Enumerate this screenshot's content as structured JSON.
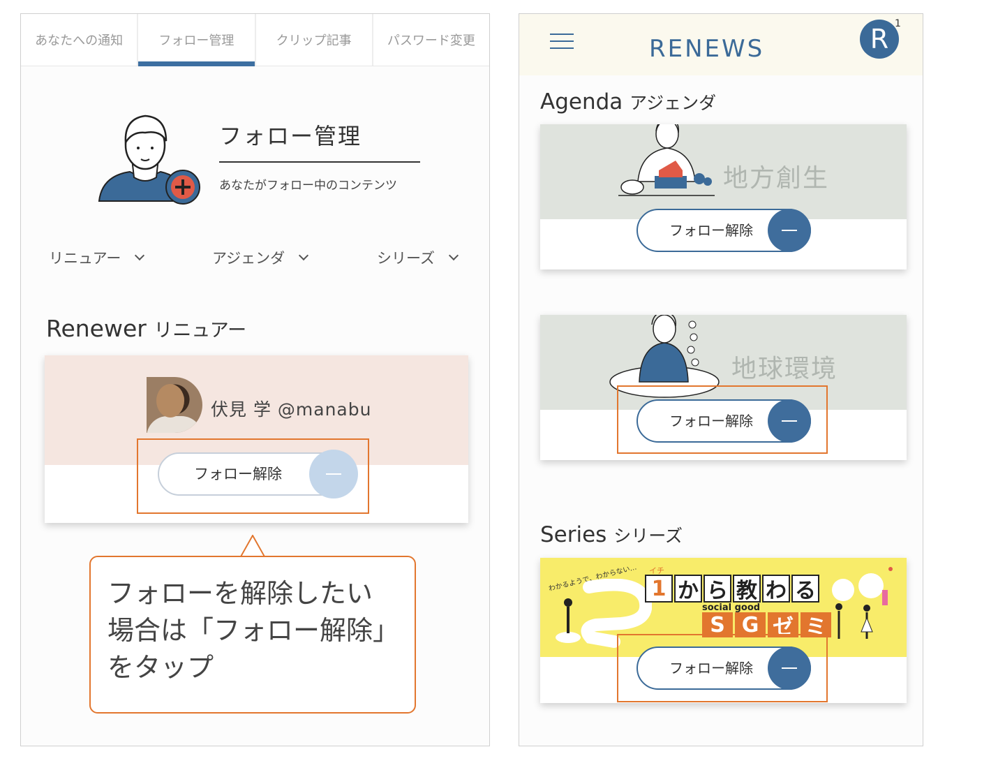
{
  "left": {
    "tabs": [
      {
        "label": "あなたへの通知"
      },
      {
        "label": "フォロー管理"
      },
      {
        "label": "クリップ記事"
      },
      {
        "label": "パスワード変更"
      }
    ],
    "hero": {
      "title": "フォロー管理",
      "subtitle": "あなたがフォロー中のコンテンツ"
    },
    "filters": [
      {
        "label": "リニュアー"
      },
      {
        "label": "アジェンダ"
      },
      {
        "label": "シリーズ"
      }
    ],
    "section": {
      "title_en": "Renewer",
      "title_jp": "リニュアー"
    },
    "renewer": {
      "name": "伏見 学 @manabu",
      "unfollow_label": "フォロー解除"
    },
    "callout": {
      "text": "フォローを解除したい\n場合は「フォロー解除」\nをタップ"
    }
  },
  "right": {
    "logo": "RENEWS",
    "notification_count": "1",
    "user_icon": "R",
    "agenda": {
      "title_en": "Agenda",
      "title_jp": "アジェンダ",
      "items": [
        {
          "label": "地方創生",
          "unfollow_label": "フォロー解除"
        },
        {
          "label": "地球環境",
          "unfollow_label": "フォロー解除"
        }
      ]
    },
    "series": {
      "title_en": "Series",
      "title_jp": "シリーズ",
      "banner": {
        "kana": "イチ",
        "tagline": "わかるようで、わからない…",
        "title_chars": [
          "1",
          "か",
          "ら",
          "教",
          "わ",
          "る"
        ],
        "sub": "social good",
        "row_chars": [
          "S",
          "G",
          "ゼ",
          "ミ"
        ]
      },
      "unfollow_label": "フォロー解除"
    }
  },
  "colors": {
    "accent": "#3b6a98",
    "highlight": "#e2762e",
    "renewer_bg": "#f5e6e0",
    "topic_bg": "#dfe3dd",
    "series_bg": "#f8ec6a"
  }
}
